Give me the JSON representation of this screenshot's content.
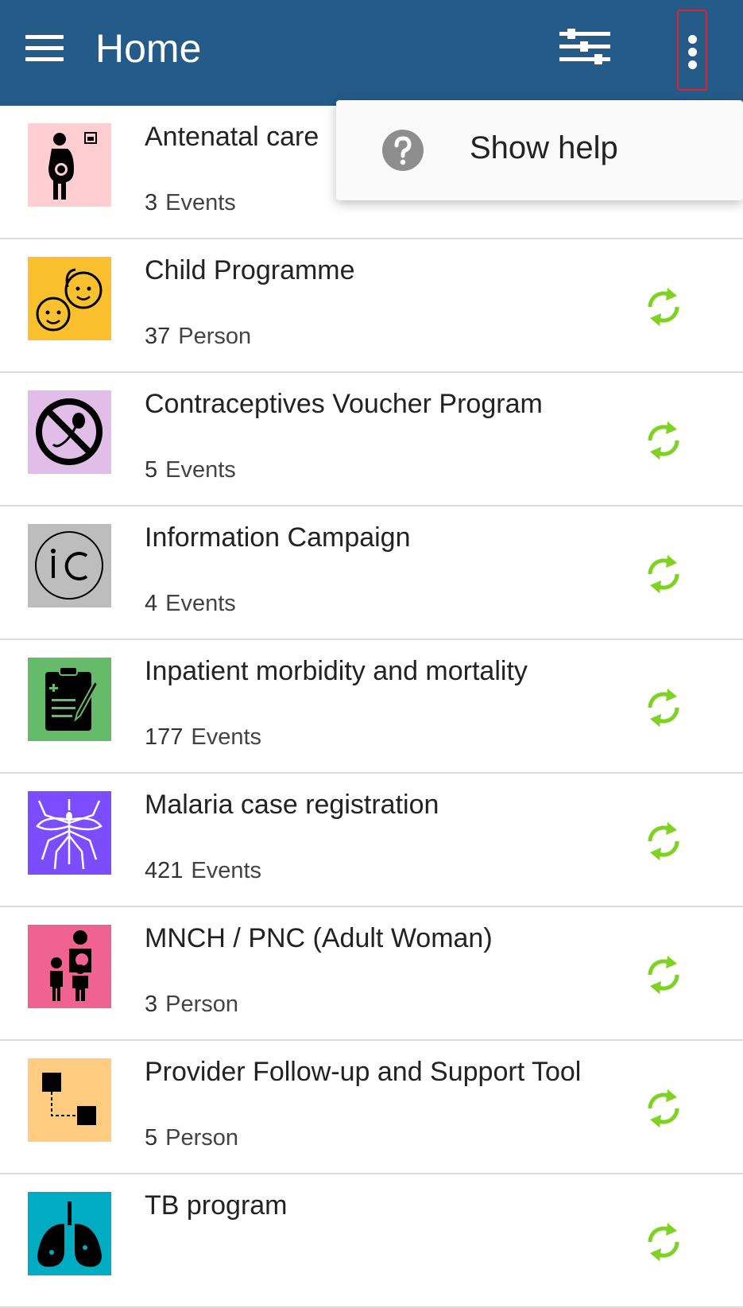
{
  "appbar": {
    "title": "Home",
    "background": "#255b89"
  },
  "overflow_menu": {
    "items": [
      {
        "label": "Show help",
        "icon": "help-circle-icon"
      }
    ]
  },
  "programs": [
    {
      "name": "Antenatal care",
      "count": "3",
      "unit": "Events",
      "icon": "pregnant-woman-icon",
      "tile_color": "#ffcdd2"
    },
    {
      "name": "Child Programme",
      "count": "37",
      "unit": "Person",
      "icon": "children-faces-icon",
      "tile_color": "#fbc02d"
    },
    {
      "name": "Contraceptives Voucher Program",
      "count": "5",
      "unit": "Events",
      "icon": "no-sperm-icon",
      "tile_color": "#e1bee7"
    },
    {
      "name": "Information Campaign",
      "count": "4",
      "unit": "Events",
      "icon": "ic-circle-icon",
      "tile_color": "#bdbdbd"
    },
    {
      "name": "Inpatient morbidity and mortality",
      "count": "177",
      "unit": "Events",
      "icon": "clipboard-icon",
      "tile_color": "#66bb6a"
    },
    {
      "name": "Malaria case registration",
      "count": "421",
      "unit": "Events",
      "icon": "mosquito-icon",
      "tile_color": "#7c4dff"
    },
    {
      "name": "MNCH / PNC (Adult Woman)",
      "count": "3",
      "unit": "Person",
      "icon": "family-icon",
      "tile_color": "#f06292"
    },
    {
      "name": "Provider Follow-up and Support Tool",
      "count": "5",
      "unit": "Person",
      "icon": "flow-boxes-icon",
      "tile_color": "#ffcc80"
    },
    {
      "name": "TB program",
      "count": "",
      "unit": "",
      "icon": "lungs-icon",
      "tile_color": "#00acc1"
    }
  ],
  "sync_color": "#7ed321"
}
